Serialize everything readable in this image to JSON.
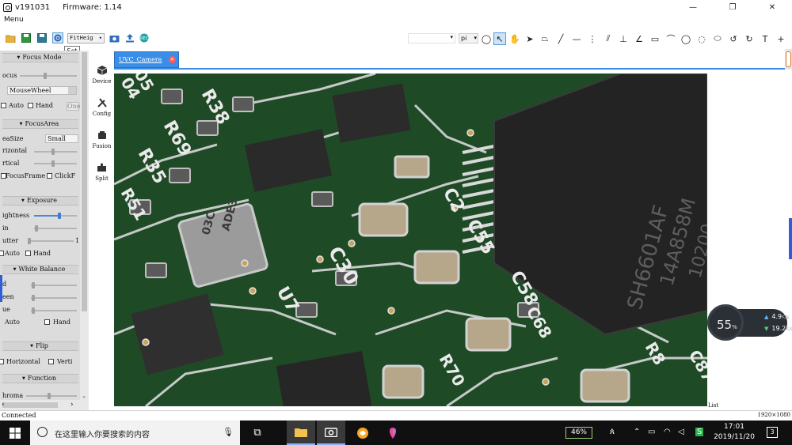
{
  "window": {
    "title": "v191031",
    "firmware": "Firmware: 1.14",
    "minimize": "—",
    "maximize": "❐",
    "close": "✕"
  },
  "menu": {
    "label": "Menu"
  },
  "toolbar": {
    "icons": [
      "open-folder-icon",
      "save-icon",
      "save-as-icon",
      "settings-icon",
      "snapshot-icon",
      "export-icon",
      "record-icon"
    ],
    "fit_label": "FitHeig",
    "tooltip": "Set",
    "unit_label": "pi"
  },
  "left_panel": {
    "focus_mode": {
      "title": "Focus Mode",
      "focus_label": "ocus",
      "mousewheel": "MouseWheel",
      "auto": "Auto",
      "hand": "Hand",
      "one": "One"
    },
    "focus_area": {
      "title": "FocusArea",
      "area_size": "eaSize",
      "area_value": "Small",
      "horizontal": "rizontal",
      "vertical": "rtical",
      "focus_frame": "FocusFrame",
      "click_f": "ClickF"
    },
    "exposure": {
      "title": "Exposure",
      "brightness": "ightness",
      "gain": "in",
      "shutter": "utter",
      "shutter_max": "1",
      "auto": "Auto",
      "hand": "Hand"
    },
    "white_balance": {
      "title": "White Balance",
      "red": "d",
      "green": "een",
      "blue": "ue",
      "auto": "Auto",
      "hand": "Hand"
    },
    "flip": {
      "title": "Flip",
      "horizontal": "Horizontal",
      "vertical": "Verti"
    },
    "function": {
      "title": "Function",
      "chroma": "hroma"
    },
    "levels": {
      "focus": 0.45,
      "horizontal": 0.45,
      "vertical": 0.45,
      "brightness": 0.6,
      "gain": 0.05,
      "shutter": 0.0,
      "red": 0.05,
      "green": 0.05,
      "blue": 0.05,
      "chroma": 0.45
    }
  },
  "side_tabs": [
    {
      "label": "Device",
      "icon": "cube-icon"
    },
    {
      "label": "Config",
      "icon": "tools-icon"
    },
    {
      "label": "Fusion",
      "icon": "stack-icon"
    },
    {
      "label": "Split",
      "icon": "puzzle-icon"
    }
  ],
  "doc_tab": {
    "label": "UVC_Camera"
  },
  "camera_view": {
    "labels": [
      "R38",
      "R69",
      "R35",
      "04",
      "05",
      "R51",
      "C2",
      "U7",
      "C30",
      "C55",
      "C58",
      "C68",
      "R70",
      "R8",
      "C87",
      "03C",
      "ADE3",
      "SH6601AF",
      "14A858M",
      "10200"
    ]
  },
  "list_label": "List",
  "status": {
    "left": "Connected",
    "right": "1920×1080"
  },
  "speed_widget": {
    "percent": "55",
    "percent_unit": "%",
    "upload": "4.9",
    "download": "19.2",
    "unit": "K/s"
  },
  "taskbar": {
    "search_placeholder": "在这里输入你要搜索的内容",
    "battery": "46%",
    "ime": "S",
    "time": "17:01",
    "date": "2019/11/20",
    "notif": "3"
  },
  "colors": {
    "accent": "#3a8ee6",
    "taskbar": "#101010",
    "panel": "#dcdcdc"
  }
}
